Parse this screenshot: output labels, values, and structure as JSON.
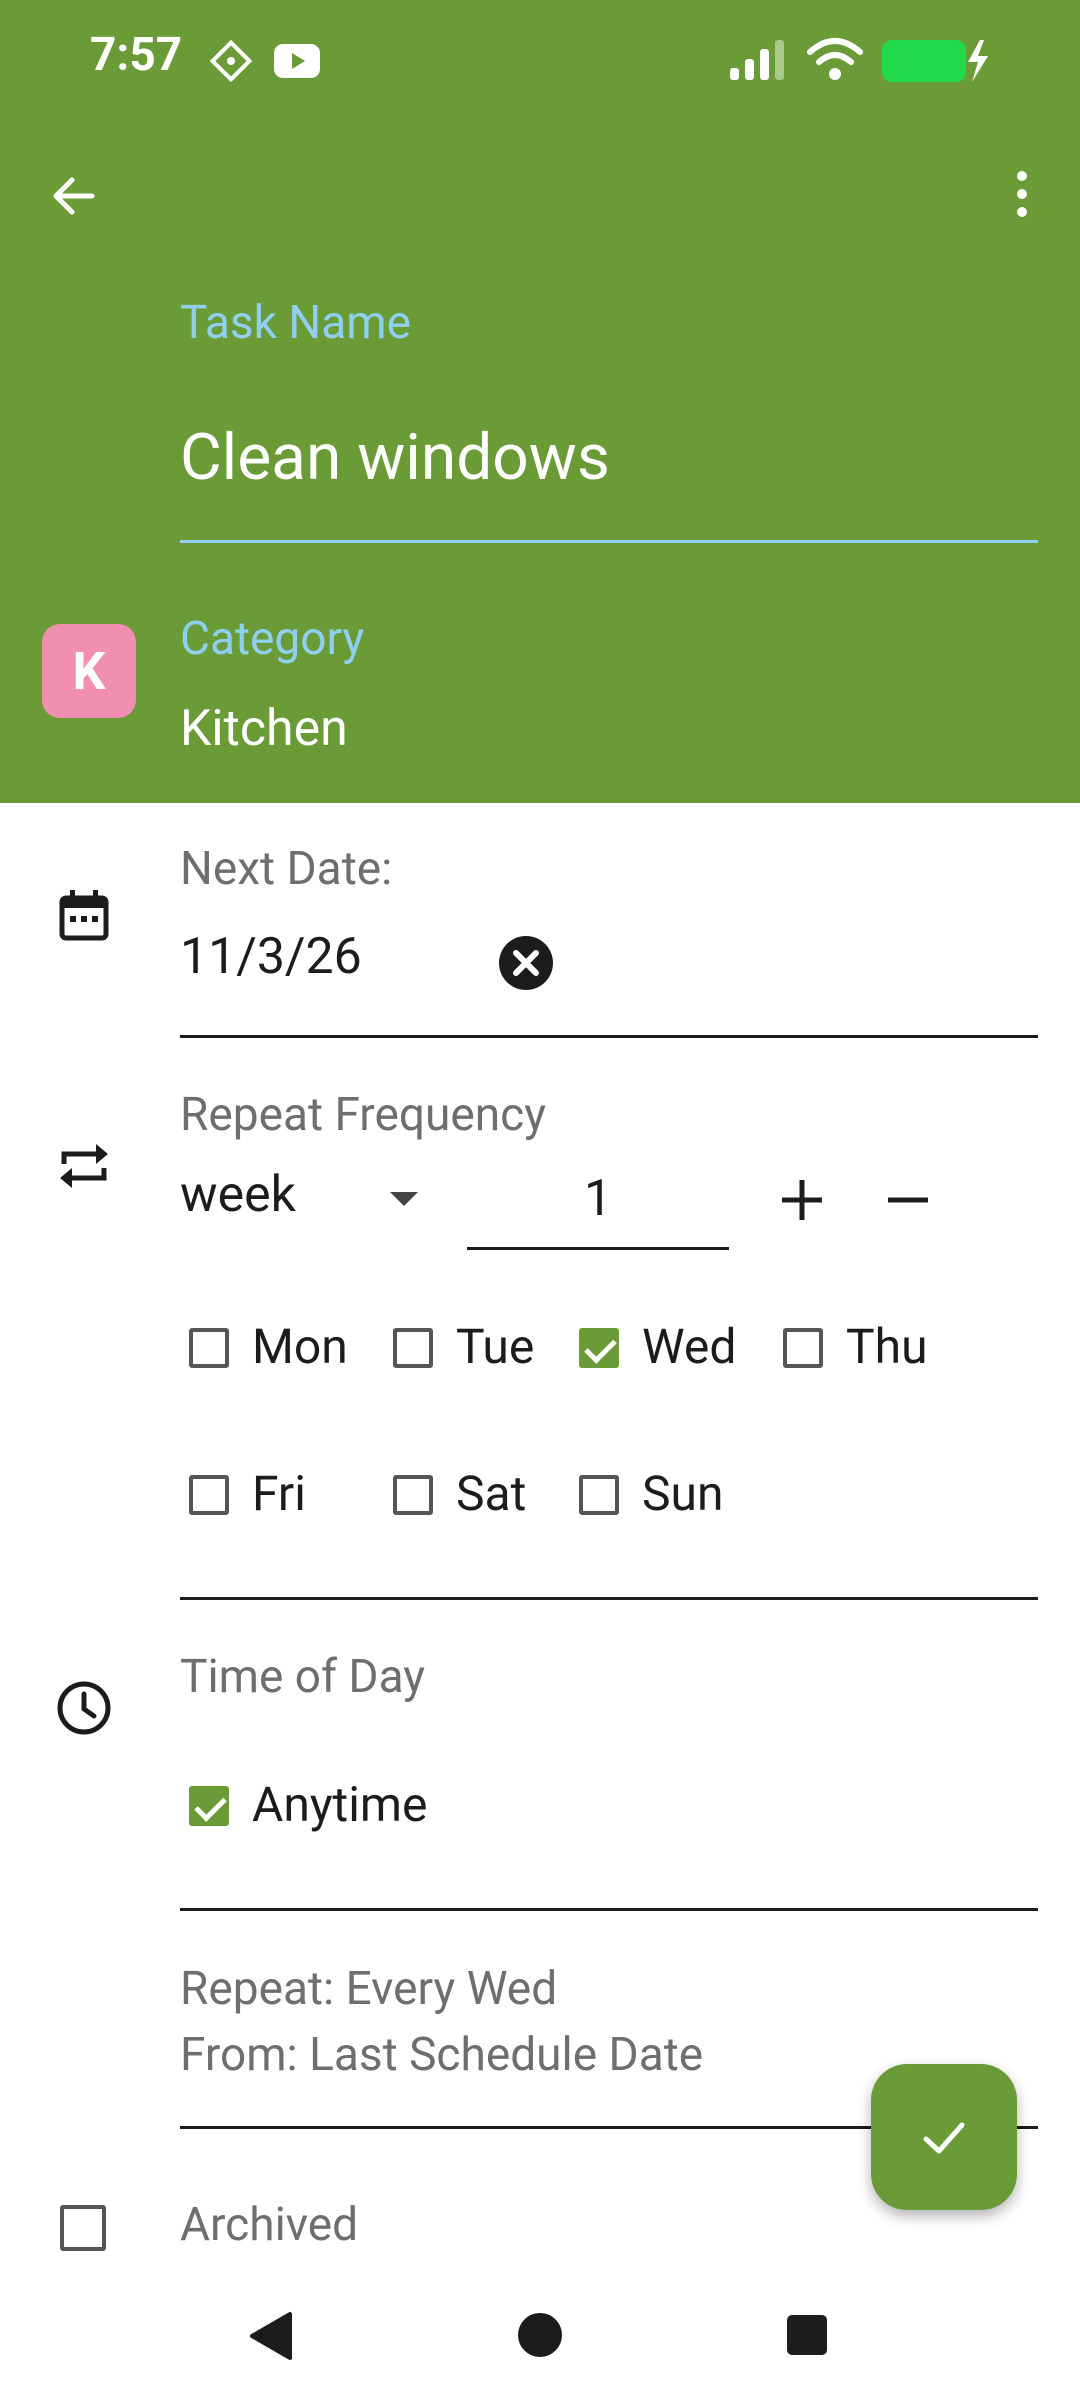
{
  "status_bar": {
    "time": "7:57"
  },
  "task": {
    "label": "Task Name",
    "value": "Clean windows"
  },
  "category": {
    "badge_letter": "K",
    "label": "Category",
    "value": "Kitchen"
  },
  "next_date": {
    "label": "Next Date:",
    "value": "11/3/26"
  },
  "repeat": {
    "label": "Repeat Frequency",
    "unit": "week",
    "count": "1",
    "days": [
      {
        "label": "Mon",
        "checked": false
      },
      {
        "label": "Tue",
        "checked": false
      },
      {
        "label": "Wed",
        "checked": true
      },
      {
        "label": "Thu",
        "checked": false
      },
      {
        "label": "Fri",
        "checked": false
      },
      {
        "label": "Sat",
        "checked": false
      },
      {
        "label": "Sun",
        "checked": false
      }
    ]
  },
  "time_of_day": {
    "label": "Time of Day",
    "anytime_label": "Anytime",
    "anytime_checked": true
  },
  "summary": {
    "line1": "Repeat: Every Wed",
    "line2": "From: Last Schedule Date"
  },
  "archived": {
    "label": "Archived",
    "checked": false
  },
  "colors": {
    "header": "#6b9b37",
    "accent_blue": "#8fd0f0",
    "category_badge": "#f08fb0"
  }
}
